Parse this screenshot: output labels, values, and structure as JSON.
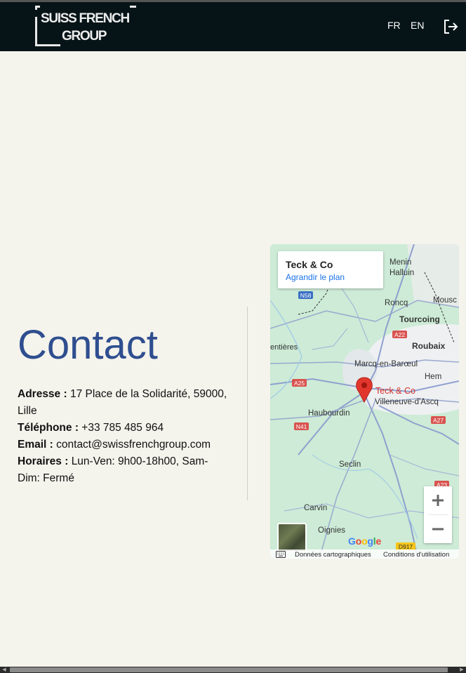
{
  "header": {
    "logo_line1": "SUISS FRENCH",
    "logo_line2": "GROUP",
    "lang_fr": "FR",
    "lang_en": "EN",
    "logout_icon": "logout-icon"
  },
  "contact": {
    "title": "Contact",
    "address_label": "Adresse :",
    "address_value": "17 Place de la Solidarité, 59000, Lille",
    "phone_label": "Téléphone :",
    "phone_value": "+33 785 485 964",
    "email_label": "Email :",
    "email_value": "contact@swissfrenchgroup.com",
    "hours_label": "Horaires :",
    "hours_value": "Lun-Ven: 9h00-18h00, Sam-Dim: Fermé"
  },
  "map": {
    "place_name": "Teck & Co",
    "enlarge_link": "Agrandir le plan",
    "marker_label": "Teck & Co",
    "google_letters": [
      {
        "ch": "G",
        "color": "#4285f4"
      },
      {
        "ch": "o",
        "color": "#ea4335"
      },
      {
        "ch": "o",
        "color": "#fbbc05"
      },
      {
        "ch": "g",
        "color": "#4285f4"
      },
      {
        "ch": "l",
        "color": "#34a853"
      },
      {
        "ch": "e",
        "color": "#ea4335"
      }
    ],
    "map_data": "Données cartographiques",
    "terms": "Conditions d'utilisation",
    "towns": {
      "menin": "Menin",
      "halluin": "Halluin",
      "roncq": "Roncq",
      "mouscron": "Mousc",
      "tourcoing": "Tourcoing",
      "armentieres": "entières",
      "roubaix": "Roubaix",
      "marcq": "Marcq-en-Barœul",
      "hem": "Hem",
      "villeneuve": "Villeneuve-d'Ascq",
      "haubourdin": "Haubourdin",
      "seclin": "Seclin",
      "carvin": "Carvin",
      "oignies": "Oignies"
    },
    "roads": {
      "n58": "N58",
      "a22": "A22",
      "a25": "A25",
      "n41": "N41",
      "a27": "A27",
      "a23": "A23",
      "d917": "D917"
    }
  }
}
